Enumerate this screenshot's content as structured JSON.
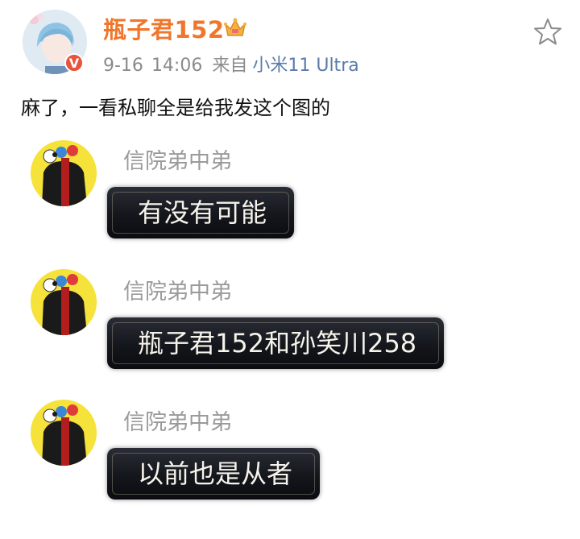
{
  "post": {
    "username": "瓶子君152",
    "date": "9-16",
    "time": "14:06",
    "source_prefix": "来自",
    "device": "小米11 Ultra",
    "text": "麻了，一看私聊全是给我发这个图的"
  },
  "messages": [
    {
      "sender": "信院弟中弟",
      "text": "有没有可能"
    },
    {
      "sender": "信院弟中弟",
      "text": "瓶子君152和孙笑川258"
    },
    {
      "sender": "信院弟中弟",
      "text": "以前也是从者"
    }
  ],
  "colors": {
    "username": "#f0762b",
    "device": "#5a7ba8",
    "meta": "#8b8b8b",
    "sender": "#9a9a9a",
    "bubble_bg": "#14161c",
    "avatar_yellow": "#f5e23a"
  },
  "icons": [
    "crown-icon",
    "verified-badge-icon",
    "favorite-star-icon"
  ]
}
